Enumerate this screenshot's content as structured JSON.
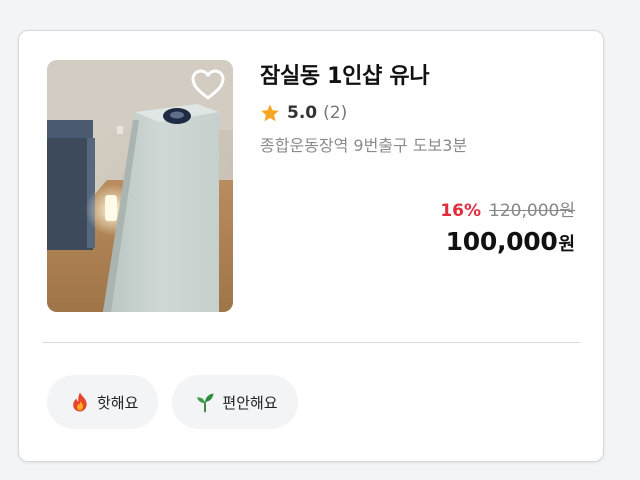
{
  "shop": {
    "name": "잠실동 1인샵 유나",
    "rating": "5.0",
    "review_count": "(2)",
    "location": "종합운동장역 9번출구 도보3분",
    "image_alt": "massage bed room photo",
    "wishlist_icon": "heart-outline-icon"
  },
  "price": {
    "discount_rate": "16%",
    "original_price": "120,000원",
    "final_amount": "100,000",
    "final_unit": "원"
  },
  "tags": [
    {
      "label": "핫해요",
      "icon": "fire-icon"
    },
    {
      "label": "편안해요",
      "icon": "sprout-icon"
    }
  ],
  "colors": {
    "discount": "#e02c3c",
    "star": "#f5a623",
    "tag_bg": "#f3f4f6",
    "card_border": "#d6d8dc"
  }
}
